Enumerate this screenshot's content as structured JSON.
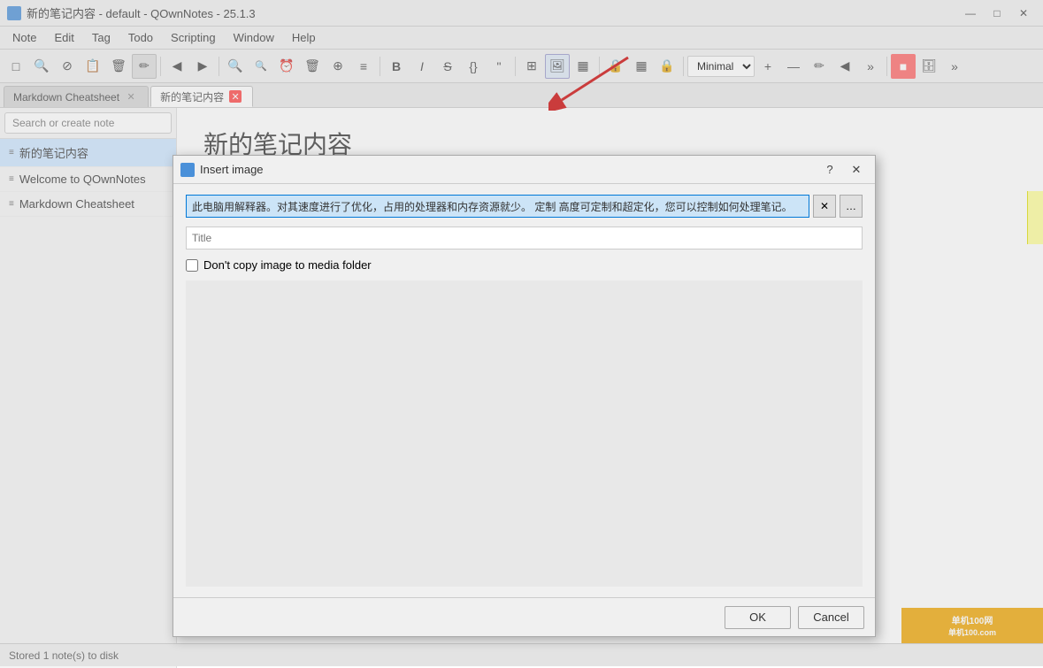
{
  "app": {
    "title": "新的笔记内容 - default - QOwnNotes - 25.1.3",
    "icon": "qownnotes-icon"
  },
  "titlebar": {
    "title": "新的笔记内容 - default - QOwnNotes - 25.1.3",
    "minimize": "—",
    "maximize": "□",
    "close": "✕"
  },
  "menubar": {
    "items": [
      "Note",
      "Edit",
      "Tag",
      "Todo",
      "Scripting",
      "Window",
      "Help"
    ]
  },
  "toolbar": {
    "buttons": [
      "□",
      "🔍",
      "⊘",
      "📋",
      "🗑",
      "✏",
      "◀",
      "▶",
      "🔍",
      "🔍",
      "⏰",
      "🗑",
      "⊕",
      "≡",
      "B",
      "I",
      "S",
      "{}",
      "\"",
      "⊞",
      "🖼",
      "▦",
      "🔒",
      "▦",
      "🔒"
    ],
    "dropdown_value": "Minimal",
    "plus": "+",
    "minus": "—",
    "pencil": "✏",
    "back2": "◀",
    "more": "»"
  },
  "tabs": [
    {
      "label": "Markdown Cheatsheet",
      "active": false,
      "closable": true
    },
    {
      "label": "新的笔记内容",
      "active": true,
      "closable": true
    }
  ],
  "sidebar": {
    "search_placeholder": "Search or create note",
    "notes": [
      {
        "label": "新的笔记内容",
        "active": true
      },
      {
        "label": "Welcome to QOwnNotes",
        "active": false
      },
      {
        "label": "Markdown Cheatsheet",
        "active": false
      }
    ]
  },
  "editor": {
    "note_title": "新的笔记内容"
  },
  "dialog": {
    "title": "Insert image",
    "icon": "insert-image-icon",
    "url_value": "此电脑用解释器。对其速度进行了优化，占用的处理器和内存资源就少。 定制 高度可定制和超定化，您可以控制如何处理笔记。",
    "title_placeholder": "Title",
    "checkbox_label": "Don't copy image to media folder",
    "ok_label": "OK",
    "cancel_label": "Cancel",
    "help_label": "?",
    "close_label": "✕"
  },
  "statusbar": {
    "text": "Stored 1 note(s) to disk"
  },
  "watermark": {
    "text": "单机100网\n单机100.com"
  }
}
